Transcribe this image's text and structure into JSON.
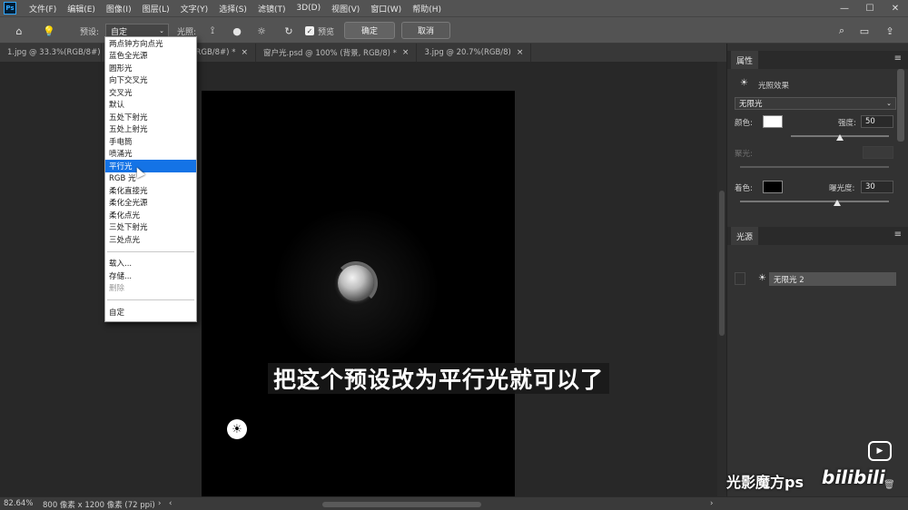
{
  "menubar": {
    "logo": "Ps",
    "items": [
      "文件(F)",
      "编辑(E)",
      "图像(I)",
      "图层(L)",
      "文字(Y)",
      "选择(S)",
      "滤镜(T)",
      "3D(D)",
      "视图(V)",
      "窗口(W)",
      "帮助(H)"
    ],
    "window_controls": [
      "—",
      "☐",
      "✕"
    ]
  },
  "optbar": {
    "preset_label": "预设:",
    "preset_value": "自定",
    "light_label": "光照:",
    "preview_label": "预览",
    "preview_checked": true,
    "ok_label": "确定",
    "cancel_label": "取消"
  },
  "tabs": [
    {
      "label": "1.jpg @ 33.3%(RGB/8#)"
    },
    {
      "label": "RGB/8#) *"
    },
    {
      "label": "窗户光.psd @ 100% (背景, RGB/8) *"
    },
    {
      "label": "3.jpg @ 20.7%(RGB/8)"
    }
  ],
  "preset_dropdown": {
    "group1": [
      "两点钟方向点光",
      "蓝色全光源",
      "圆形光",
      "向下交叉光",
      "交叉光",
      "默认",
      "五处下射光",
      "五处上射光",
      "手电筒",
      "喷涌光",
      "平行光",
      "RGB 光",
      "柔化直接光",
      "柔化全光源",
      "柔化点光",
      "三处下射光",
      "三处点光"
    ],
    "selected": "平行光",
    "group2": [
      "载入...",
      "存储...",
      "删除"
    ],
    "disabled": "删除",
    "group3": [
      "自定"
    ]
  },
  "caption": "把这个预设改为平行光就可以了",
  "properties_panel": {
    "tab": "属性",
    "effect_title": "光照效果",
    "light_type": "无限光",
    "color_label": "颜色:",
    "intensity_label": "强度:",
    "intensity_value": "50",
    "intensity_level": 0.5,
    "hotspot_label": "聚光:",
    "tint_label": "着色:",
    "exposure_label": "曝光度:",
    "exposure_value": "30",
    "exposure_level": 0.3,
    "light_color": "#ffffff",
    "tint_color": "#000000"
  },
  "light_source_panel": {
    "tab": "光源",
    "item": "无限光 2"
  },
  "statusbar": {
    "zoom": "82.64%",
    "doc_info": "800 像素 x 1200 像素 (72 ppi)"
  },
  "watermark": {
    "text": "光影魔方ps",
    "brand": "bilibili"
  }
}
